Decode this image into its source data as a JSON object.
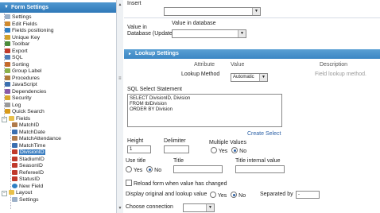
{
  "tree": {
    "title": "Form Settings",
    "items": [
      {
        "label": "Settings",
        "icon": "page-icon",
        "color": "#9cb0c8"
      },
      {
        "label": "Edit Fields",
        "icon": "pencil-icon",
        "color": "#d08a2e"
      },
      {
        "label": "Fields positioning",
        "icon": "move-icon",
        "color": "#2f7fc4"
      },
      {
        "label": "Unique Key",
        "icon": "key-icon",
        "color": "#d2a12a"
      },
      {
        "label": "Toolbar",
        "icon": "toolbar-icon",
        "color": "#4b8a3a"
      },
      {
        "label": "Export",
        "icon": "export-icon",
        "color": "#c23a2a"
      },
      {
        "label": "SQL",
        "icon": "sql-icon",
        "color": "#4d7db8"
      },
      {
        "label": "Sorting",
        "icon": "sort-icon",
        "color": "#c56a2a"
      },
      {
        "label": "Group Label",
        "icon": "group-icon",
        "color": "#8ab04a"
      },
      {
        "label": "Procedures",
        "icon": "procedure-icon",
        "color": "#b07a3a"
      },
      {
        "label": "JavaScript",
        "icon": "javascript-icon",
        "color": "#3a6fb0"
      },
      {
        "label": "Dependencies",
        "icon": "link-icon",
        "color": "#8a5aa8"
      },
      {
        "label": "Security",
        "icon": "shield-icon",
        "color": "#d9a82e"
      },
      {
        "label": "Log",
        "icon": "log-icon",
        "color": "#9a9a9a"
      },
      {
        "label": "Quick Search",
        "icon": "search-icon",
        "color": "#d89a1a"
      },
      {
        "label": "Fields",
        "icon": "folder-icon",
        "color": "#e8c04a"
      },
      {
        "label": "MatchID",
        "icon": "field-icon",
        "color": "#b07a4a"
      },
      {
        "label": "MatchDate",
        "icon": "calendar-icon",
        "color": "#3a6fb0"
      },
      {
        "label": "MatchAttendance",
        "icon": "field-icon",
        "color": "#b07a4a"
      },
      {
        "label": "MatchTime",
        "icon": "clock-icon",
        "color": "#3a6fb0"
      },
      {
        "label": "DivisionID",
        "icon": "select-field-icon",
        "color": "#c0392b"
      },
      {
        "label": "StadiumID",
        "icon": "select-field-icon",
        "color": "#c0392b"
      },
      {
        "label": "SeasonID",
        "icon": "select-field-icon",
        "color": "#c0392b"
      },
      {
        "label": "RefereeID",
        "icon": "select-field-icon",
        "color": "#c0392b"
      },
      {
        "label": "StatusID",
        "icon": "select-field-icon",
        "color": "#c0392b"
      },
      {
        "label": "New Field",
        "icon": "add-icon",
        "color": "#2f7fc4"
      },
      {
        "label": "Layout",
        "icon": "folder-icon",
        "color": "#e8c04a"
      },
      {
        "label": "Settings",
        "icon": "page-icon",
        "color": "#9cb0c8"
      }
    ]
  },
  "main": {
    "insert_label": "Insert",
    "value_in_database_label": "Value in database",
    "value_in_db_update_label_1": "Value in",
    "value_in_db_update_label_2": "Database (Update)",
    "section_title": "Lookup Settings",
    "col_attribute": "Attribute",
    "col_value": "Value",
    "col_description": "Description",
    "lookup_method_label": "Lookup Method",
    "lookup_method_value": "Automatic",
    "lookup_method_description": "Field lookup method.",
    "sql_label": "SQL Select Statement",
    "sql_lines": [
      "SELECT DivisionID, Division",
      "FROM tblDivision",
      "ORDER BY Division"
    ],
    "create_select": "Create Select",
    "height_label": "Height",
    "height_value": "1",
    "delimiter_label": "Delimiter",
    "multiple_values_label": "Multiple Values",
    "yes": "Yes",
    "no": "No",
    "use_title_label": "Use title",
    "title_label": "Title",
    "title_internal_label": "Title internal value",
    "reload_label": "Reload form when value has changed",
    "display_original_label": "Display original and lookup value",
    "separated_by_label": "Separated by",
    "separated_by_value": "-",
    "choose_connection_label": "Choose connection"
  },
  "colors": {
    "accent": "#3d7fc1",
    "link": "#2a5fa5"
  }
}
